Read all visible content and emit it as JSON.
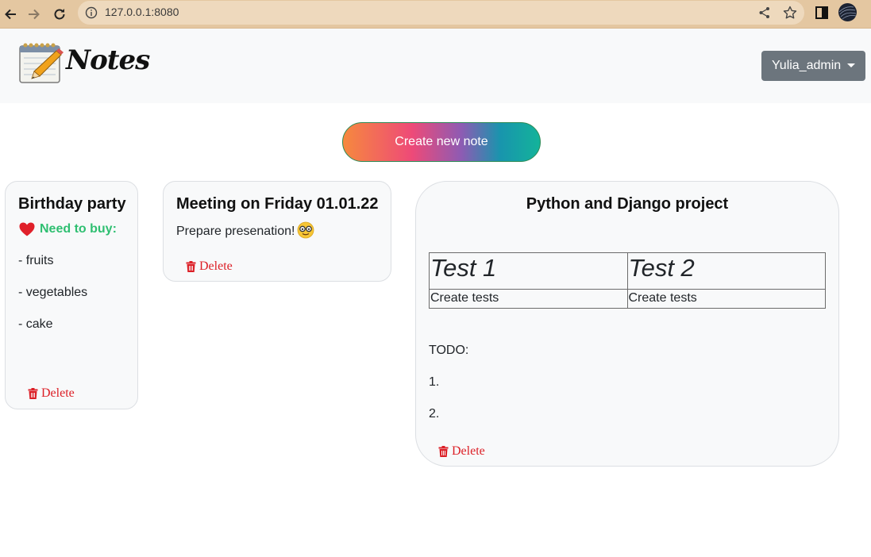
{
  "browser": {
    "url": "127.0.0.1:8080",
    "icons": [
      "back-icon",
      "forward-icon",
      "reload-icon",
      "info-icon",
      "share-icon",
      "star-icon",
      "side-panel-icon",
      "profile-avatar"
    ]
  },
  "header": {
    "brand": "Notes",
    "user_menu_label": "Yulia_admin"
  },
  "create_button_label": "Create new note",
  "notes": [
    {
      "title": "Birthday party",
      "subheading": "Need to buy:",
      "items": [
        "- fruits",
        "- vegetables",
        "- cake"
      ],
      "delete_label": "Delete"
    },
    {
      "title": "Meeting on Friday 01.01.22",
      "body": "Prepare presenation!",
      "delete_label": "Delete"
    },
    {
      "title": "Python and Django project",
      "table": {
        "headers": [
          "Test 1",
          "Test 2"
        ],
        "row": [
          "Create tests",
          "Create tests"
        ]
      },
      "todo_label": "TODO:",
      "todo_items": [
        "1.",
        "2."
      ],
      "delete_label": "Delete"
    }
  ],
  "colors": {
    "chrome": "#e4c7a1",
    "header_bg": "#f8f9fa",
    "user_button": "#6c757d",
    "delete": "#dc1f26",
    "need_to_buy": "#2fbf71"
  }
}
